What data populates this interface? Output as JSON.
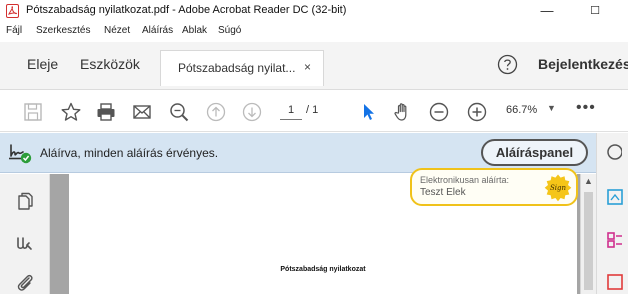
{
  "window": {
    "title": "Pótszabadság nyilatkozat.pdf - Adobe Acrobat Reader DC (32-bit)",
    "minimize_glyph": "—",
    "maximize_glyph": "☐"
  },
  "menu": {
    "items": [
      "Fájl",
      "Szerkesztés",
      "Nézet",
      "Aláírás",
      "Ablak",
      "Súgó"
    ]
  },
  "tabs": {
    "home": "Eleje",
    "tools": "Eszközök",
    "document": "Pótszabadság nyilat...",
    "close_glyph": "×",
    "sign_in": "Bejelentkezés"
  },
  "toolbar": {
    "current_page": "1",
    "page_total": "/ 1",
    "zoom": "66.7%",
    "zoom_caret": "▼",
    "more": "•••",
    "icons": [
      "save-icon",
      "star-icon",
      "print-icon",
      "email-icon",
      "zoom-search-icon",
      "page-up-icon",
      "page-down-icon",
      "select-pointer-icon",
      "hand-tool-icon",
      "zoom-out-icon",
      "zoom-in-icon"
    ]
  },
  "signature_bar": {
    "status": "Aláírva, minden aláírás érvényes.",
    "panel_button": "Aláíráspanel"
  },
  "signature_field": {
    "caption": "Elektronikusan aláírta:",
    "signer": "Teszt Elek",
    "seal_text": "Sign"
  },
  "document": {
    "title": "Pótszabadság nyilatkozat"
  },
  "colors": {
    "acrobat_red": "#d32f2f",
    "signature_bar_bg": "#d5e4f2",
    "seal_yellow": "#f5c518",
    "select_blue": "#1473e6"
  }
}
